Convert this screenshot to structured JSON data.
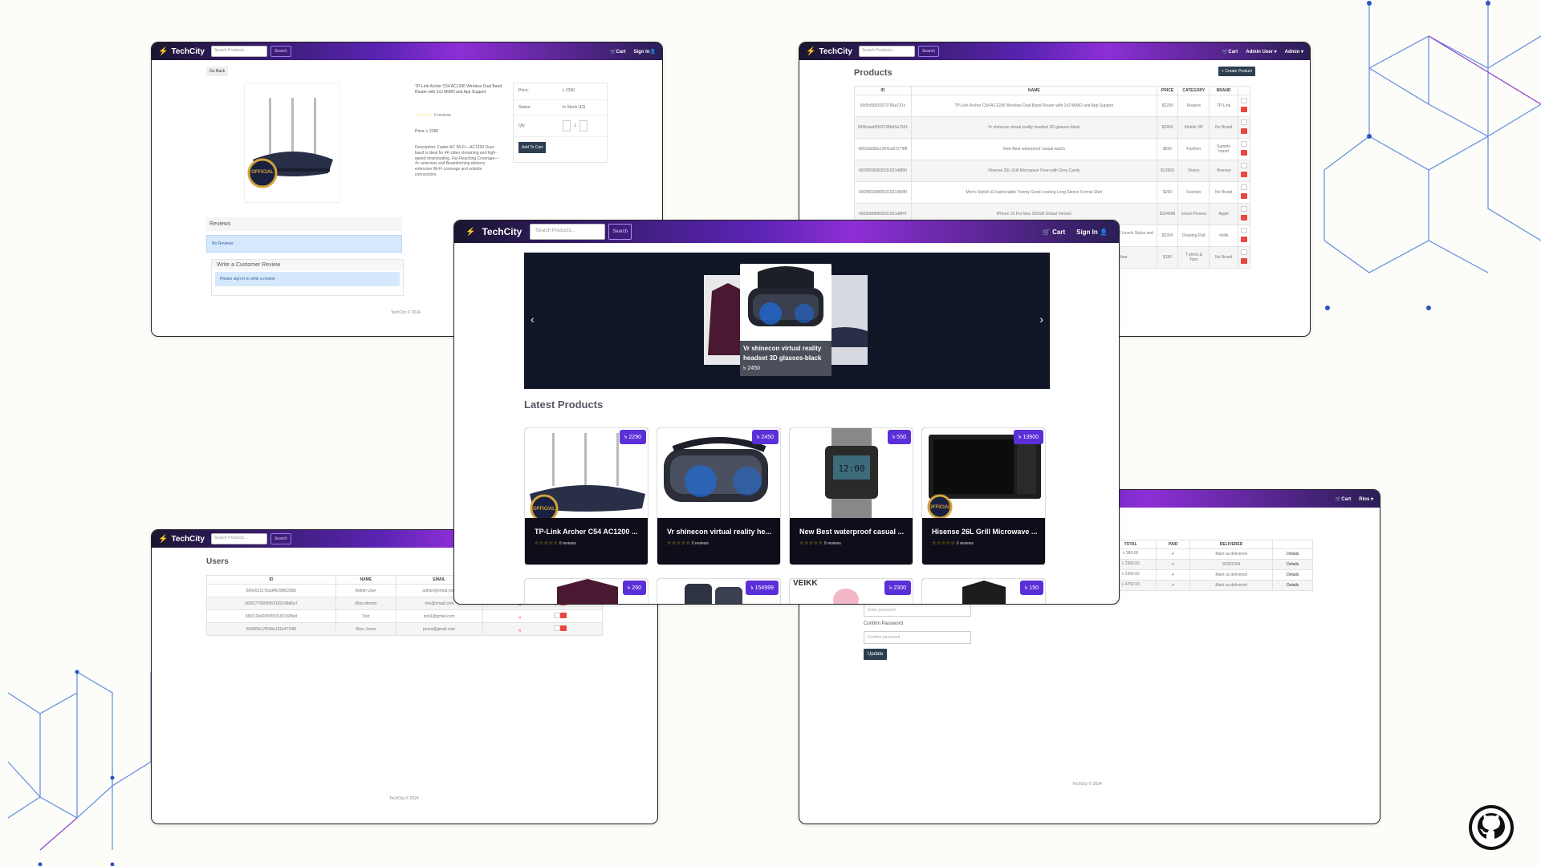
{
  "brand": "TechCity",
  "search_placeholder": "Search Products...",
  "search_button": "Search",
  "nav": {
    "cart": "Cart",
    "sign_in": "Sign In",
    "admin_user": "Admin User",
    "admin": "Admin",
    "rios": "Rios"
  },
  "footer": "TechCity © 2024",
  "product_page": {
    "go_back": "Go Back",
    "title": "TP-Link Archer C54 AC1200 Wireless Dual Band Router with 2x2 MIMO and App Support",
    "reviews_count": "0 reviews",
    "price_line": "Price: ৳ 2290",
    "description": "Description: Faster AC Wi-Fi—AC1200 Dual-band is ideal for 4K video streaming and high-speed downloading. Far-Reaching Coverage—4× antennas and Beamforming delivers extensive Wi-Fi coverage and reliable connections",
    "box": {
      "price_label": "Price:",
      "price_value": "৳ 2290",
      "status_label": "Status:",
      "status_value": "In Stock (12)",
      "qty_label": "Qty",
      "qty_value": "1",
      "add_to_cart": "Add To Cart"
    },
    "reviews_title": "Reviews",
    "no_reviews": "No Reviews",
    "write_review": "Write a Customer Review",
    "sign_in_note": "Please sign in to write a review"
  },
  "products_admin": {
    "title": "Products",
    "create_button": "Create Product",
    "columns": [
      "ID",
      "NAME",
      "PRICE",
      "CATEGORY",
      "BRAND"
    ],
    "rows": [
      [
        "66f9c85509372786a731c",
        "TP-Link Archer C54 AC1200 Wireless Dual Band Router with 2x2 MIMO and App Support",
        "$2290",
        "Routers",
        "TP-Link"
      ],
      [
        "66f9cbed39037286d3a7331",
        "Vr shinecon virtual reality headset 3D glasses-black",
        "$2450",
        "Mobile VR",
        "No Brand"
      ],
      [
        "66f1ddd3de1304ca67279f8",
        "New Best waterproof casual watch",
        "$550",
        "Fashion",
        "Sample brand"
      ],
      [
        "66f2f003080553182148f90",
        "Hisense 26L Grill Microwave Oven with Grey Cavity",
        "$13900",
        "Ovens",
        "Hisense"
      ],
      [
        "66f2f0028805531821489f0",
        "Men's Stylish & Fashionable Trendy Good Looking Long Sleeve Formal Shirt",
        "$260",
        "Fashion",
        "No Brand"
      ],
      [
        "66f39df08805531821d8f47",
        "iPhone 15 Pro Max 256GB Global Version",
        "$154999",
        "Smart Phones",
        "Apple"
      ],
      [
        "66f3bede8805531821489f55",
        "VEIKK Creator Pop VK430 8x2 inch Ultra-thin Portable OSU Tablet Digital Drawing Tablet Graphics Tablet with 8192 Levels Stylus and 4 Customized Express Keys",
        "$2300",
        "Drawing Pad",
        "Veikk"
      ],
      [
        "66f3ff0e8805531821a0f909",
        "New Soft & Comfortable Cotton Half Sleeve & Round Collar T-Shirt For Men - Comfort for Everyday Wear",
        "$150",
        "T-shirts & Tops",
        "No Brand"
      ]
    ]
  },
  "users_admin": {
    "title": "Users",
    "columns": [
      "ID",
      "NAME",
      "EMAIL"
    ],
    "rows": [
      [
        "665e621c7bad4629f902d5b",
        "Admin User",
        "admin@email.com"
      ],
      [
        "66f31770809553182168d6a7",
        "Rios ahmed",
        "rios@email.com"
      ],
      [
        "66f2134d0000553182168fad",
        "Test",
        "test1@gmail.com"
      ],
      [
        "66f405b17f038e152e4734f5",
        "Alice Jones",
        "jones@gmail.com"
      ]
    ]
  },
  "profile_admin": {
    "columns": [
      "TOTAL",
      "PAID",
      "DELIVERED"
    ],
    "rows": [
      [
        "৳ 386.00",
        "Mark as delivered",
        "Details"
      ],
      [
        "৳ 2369.00",
        "9/26/2024",
        "Details"
      ],
      [
        "৳ 2369.00",
        "Mark as delivered",
        "Details"
      ],
      [
        "৳ 4752.00",
        "Mark as delivered",
        "Details"
      ]
    ],
    "password_placeholder": "Enter password",
    "confirm_label": "Confirm Password",
    "confirm_placeholder": "Confirm password",
    "update_button": "Update"
  },
  "home": {
    "carousel_caption": "Vr shinecon virtual reality headset 3D glasses-black",
    "carousel_price": "৳ 2450",
    "latest_title": "Latest Products",
    "cards": [
      {
        "name": "TP-Link Archer C54 AC1200 ...",
        "price": "৳ 2290",
        "reviews": "0 reviews"
      },
      {
        "name": "Vr shinecon virtual reality he...",
        "price": "৳ 2450",
        "reviews": "0 reviews"
      },
      {
        "name": "New Best waterproof casual ...",
        "price": "৳ 550",
        "reviews": "0 reviews"
      },
      {
        "name": "Hisense 26L Grill Microwave ...",
        "price": "৳ 13900",
        "reviews": "0 reviews"
      }
    ],
    "row2_prices": [
      "৳ 260",
      "৳ 154999",
      "৳ 2300",
      "৳ 150"
    ],
    "row2_partial_text": "VEIKK"
  },
  "colors": {
    "accent": "#5b2fd8",
    "nav_purple": "#8d2fd6",
    "dark": "#0e0e1a",
    "danger": "#e8463f"
  },
  "icons": [
    "cart-icon",
    "user-icon",
    "chevron-left-icon",
    "chevron-right-icon",
    "github-icon",
    "star-icon",
    "check-icon",
    "edit-icon",
    "trash-icon"
  ]
}
